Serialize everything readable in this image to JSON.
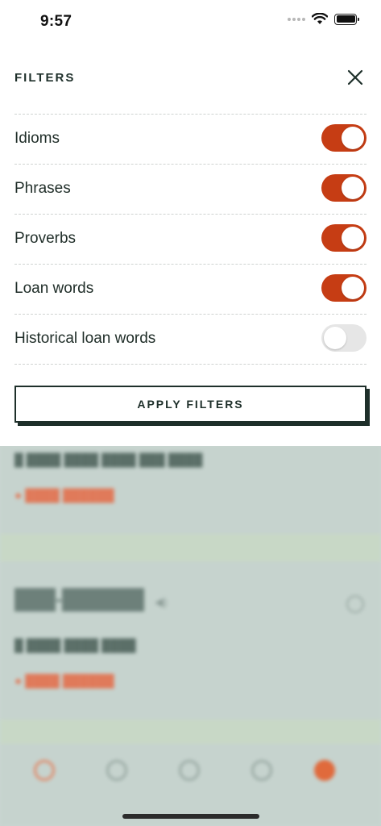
{
  "status_bar": {
    "time": "9:57"
  },
  "header": {
    "title": "FILTERS",
    "close_icon": "close-icon"
  },
  "filters": [
    {
      "label": "Idioms",
      "enabled": true
    },
    {
      "label": "Phrases",
      "enabled": true
    },
    {
      "label": "Proverbs",
      "enabled": true
    },
    {
      "label": "Loan words",
      "enabled": true
    },
    {
      "label": "Historical loan words",
      "enabled": false
    }
  ],
  "apply_button": {
    "label": "APPLY FILTERS"
  },
  "colors": {
    "toggle_on": "#c63d14",
    "toggle_off": "#e6e6e6",
    "text_dark": "#1e2f2a",
    "overlay": "#c6d3ce"
  }
}
